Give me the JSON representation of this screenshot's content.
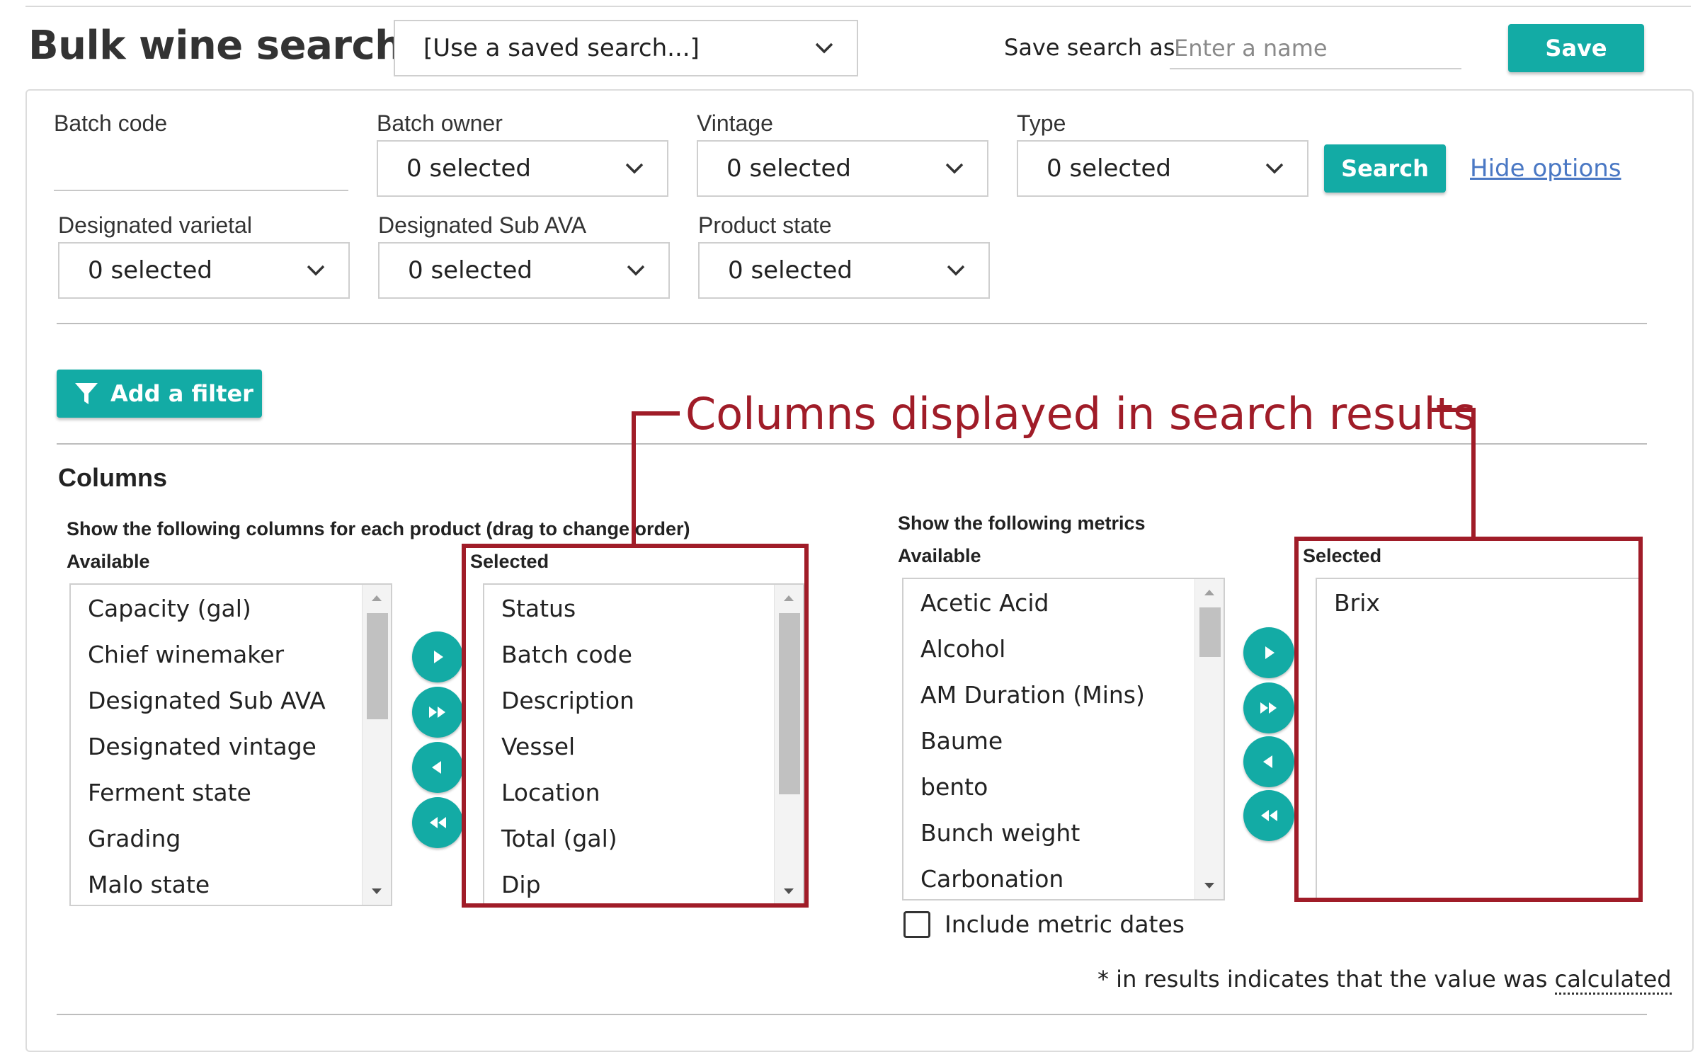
{
  "header": {
    "title": "Bulk wine search",
    "saved_search": "[Use a saved search...]",
    "save_search_label": "Save search as",
    "save_search_placeholder": "Enter a name",
    "save_button": "Save"
  },
  "filters": {
    "batch_code_label": "Batch code",
    "batch_code_value": "",
    "batch_owner_label": "Batch owner",
    "batch_owner_value": "0 selected",
    "vintage_label": "Vintage",
    "vintage_value": "0 selected",
    "type_label": "Type",
    "type_value": "0 selected",
    "search_button": "Search",
    "hide_options_link": "Hide options",
    "designated_varietal_label": "Designated varietal",
    "designated_varietal_value": "0 selected",
    "designated_sub_ava_label": "Designated Sub AVA",
    "designated_sub_ava_value": "0 selected",
    "product_state_label": "Product state",
    "product_state_value": "0 selected",
    "add_filter_button": "Add a filter"
  },
  "columns": {
    "section_title": "Columns",
    "instruction": "Show the following columns for each product (drag to change order)",
    "available_label": "Available",
    "selected_label": "Selected",
    "available_items": [
      "Capacity (gal)",
      "Chief winemaker",
      "Designated Sub AVA",
      "Designated vintage",
      "Ferment state",
      "Grading",
      "Malo state"
    ],
    "selected_items": [
      "Status",
      "Batch code",
      "Description",
      "Vessel",
      "Location",
      "Total (gal)",
      "Dip"
    ]
  },
  "metrics": {
    "instruction": "Show the following metrics",
    "available_label": "Available",
    "selected_label": "Selected",
    "available_items": [
      "Acetic Acid",
      "Alcohol",
      "AM Duration (Mins)",
      "Baume",
      "bento",
      "Bunch weight",
      "Carbonation"
    ],
    "selected_items": [
      "Brix"
    ],
    "include_dates_label": "Include metric dates",
    "include_dates_checked": false
  },
  "annotation": {
    "text": "Columns displayed in search results"
  },
  "footnote": {
    "prefix": "* in results indicates that the value was ",
    "emphasis": "calculated"
  },
  "colors": {
    "accent": "#13aba5",
    "annotation": "#a01c28",
    "link": "#4a78c4"
  }
}
